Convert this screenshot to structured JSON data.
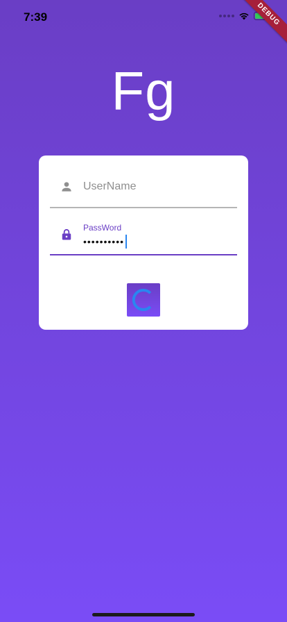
{
  "status_bar": {
    "time": "7:39"
  },
  "debug_banner": {
    "label": "DEBUG"
  },
  "logo": {
    "text": "Fg"
  },
  "login_form": {
    "username": {
      "placeholder": "UserName",
      "value": ""
    },
    "password": {
      "label": "PassWord",
      "masked_value": "••••••••••"
    }
  },
  "colors": {
    "accent": "#6a3ec5",
    "background_top": "#6a3ec5",
    "background_bottom": "#7a4cf6",
    "spinner": "#2a86f0",
    "debug": "#a6203a"
  },
  "icons": {
    "username": "person-icon",
    "password": "lock-icon",
    "submit": "loading-spinner-icon"
  }
}
